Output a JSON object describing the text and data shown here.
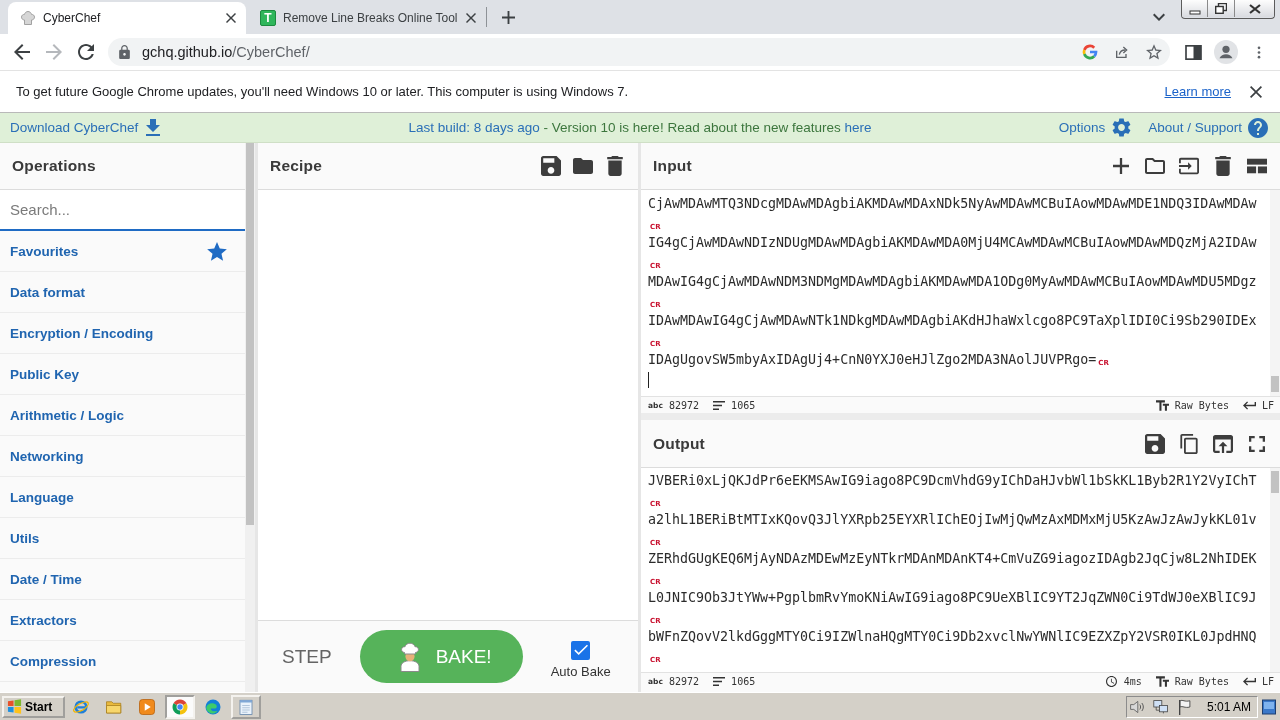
{
  "browser": {
    "tabs": [
      {
        "title": "CyberChef",
        "selected": true,
        "kind": "hat"
      },
      {
        "title": "Remove Line Breaks Online Tool",
        "selected": false,
        "kind": "letter",
        "letter": "T"
      }
    ],
    "nav": [
      {
        "kind": "back",
        "disabled": false
      },
      {
        "kind": "forward",
        "disabled": true
      },
      {
        "kind": "reload",
        "disabled": false
      }
    ],
    "address": {
      "host": "gchq.github.io",
      "path": "/CyberChef/"
    }
  },
  "infobar": {
    "message": "To get future Google Chrome updates, you'll need Windows 10 or later. This computer is using Windows 7.",
    "link": "Learn more"
  },
  "banner": {
    "download": "Download CyberChef",
    "build": "Last build: 8 days ago",
    "notice": "- Version 10 is here! Read about the new features",
    "notice_link": "here",
    "options": "Options",
    "about": "About / Support"
  },
  "operations": {
    "title": "Operations",
    "search": {
      "placeholder": "Search..."
    },
    "categories": [
      {
        "label": "Favourites",
        "kind": "favourites"
      },
      {
        "label": "Data format",
        "kind": "category"
      },
      {
        "label": "Encryption / Encoding",
        "kind": "category"
      },
      {
        "label": "Public Key",
        "kind": "category"
      },
      {
        "label": "Arithmetic / Logic",
        "kind": "category"
      },
      {
        "label": "Networking",
        "kind": "category"
      },
      {
        "label": "Language",
        "kind": "category"
      },
      {
        "label": "Utils",
        "kind": "category"
      },
      {
        "label": "Date / Time",
        "kind": "category"
      },
      {
        "label": "Extractors",
        "kind": "category"
      },
      {
        "label": "Compression",
        "kind": "category"
      }
    ]
  },
  "recipe": {
    "title": "Recipe",
    "step": "STEP",
    "bake": "BAKE!",
    "auto_bake": {
      "label": "Auto Bake",
      "checked": true
    }
  },
  "input": {
    "title": "Input",
    "lines": [
      {
        "text": "CjAwMDAwMTQ3NDcgMDAwMDAgbiAKMDAwMDAxNDk5NyAwMDAwMCBuIAowMDAwMDE1NDQ3IDAwMDAw",
        "eol": "CR"
      },
      {
        "text": "IG4gCjAwMDAwNDIzNDUgMDAwMDAgbiAKMDAwMDA0MjU4MCAwMDAwMCBuIAowMDAwMDQzMjA2IDAw",
        "eol": "CR"
      },
      {
        "text": "MDAwIG4gCjAwMDAwNDM3NDMgMDAwMDAgbiAKMDAwMDA1ODg0MyAwMDAwMCBuIAowMDAwMDU5MDgz",
        "eol": "CR"
      },
      {
        "text": "IDAwMDAwIG4gCjAwMDAwNTk1NDkgMDAwMDAgbiAKdHJhaWxlcgo8PC9TaXplIDI0Ci9Sb290IDEx",
        "eol": "CR"
      },
      {
        "text": "IDAgUgovSW5mbyAxIDAgUj4+CnN0YXJ0eHJlZgo2MDA3NAolJUVPRgo=",
        "eol": "CR"
      }
    ],
    "status": {
      "length_symbol": "abc",
      "length": "82972",
      "lines": "1065",
      "encoding": "Raw Bytes",
      "eol": "LF"
    }
  },
  "output": {
    "title": "Output",
    "lines": [
      {
        "text": "JVBERi0xLjQKJdPr6eEKMSAwIG9iago8PC9DcmVhdG9yIChDaHJvbWl1bSkKL1Byb2R1Y2VyIChT",
        "eol": "CR"
      },
      {
        "text": "a2lhL1BERiBtMTIxKQovQ3JlYXRpb25EYXRlIChEOjIwMjQwMzAxMDMxMjU5KzAwJzAwJykKL01v",
        "eol": "CR"
      },
      {
        "text": "ZERhdGUgKEQ6MjAyNDAzMDEwMzEyNTkrMDAnMDAnKT4+CmVuZG9iagozIDAgb2JqCjw8L2NhIDEK",
        "eol": "CR"
      },
      {
        "text": "L0JNIC9Ob3JtYWw+PgplbmRvYmoKNiAwIG9iago8PC9UeXBlIC9YT2JqZWN0Ci9TdWJ0eXBlIC9J",
        "eol": "CR"
      },
      {
        "text": "bWFnZQovV2lkdGggMTY0Ci9IZWlnaHQgMTY0Ci9Db2xvclNwYWNlIC9EZXZpY2VSR0IKL0JpdHNQ",
        "eol": "CR"
      }
    ],
    "status": {
      "length_symbol": "abc",
      "length": "82972",
      "lines": "1065",
      "time": "4ms",
      "encoding": "Raw Bytes",
      "eol": "LF"
    }
  },
  "taskbar": {
    "start": "Start",
    "apps": [
      {
        "kind": "ie",
        "selected": false,
        "running": false
      },
      {
        "kind": "folder",
        "selected": false,
        "running": false
      },
      {
        "kind": "media",
        "selected": false,
        "running": false
      },
      {
        "kind": "chrome",
        "selected": true,
        "running": true
      },
      {
        "kind": "edge",
        "selected": false,
        "running": false
      },
      {
        "kind": "notepad",
        "selected": false,
        "running": true
      }
    ],
    "clock": "5:01 AM"
  }
}
